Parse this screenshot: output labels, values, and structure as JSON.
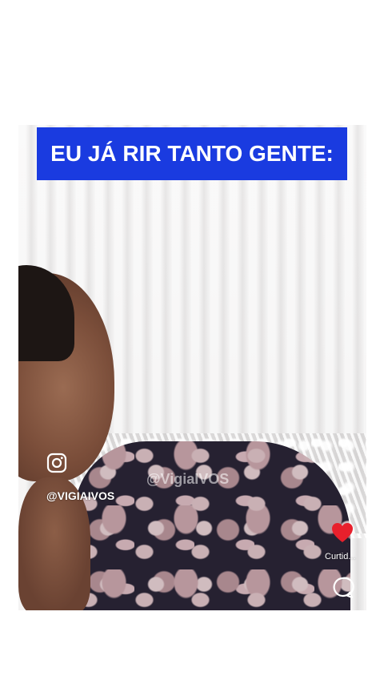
{
  "caption": "EU JÁ RIR TANTO GENTE:",
  "source": {
    "handle": "@VIGIAIVOS",
    "icon": "instagram-icon"
  },
  "watermark": "@VigiaIVOS",
  "actions": {
    "like_icon": "heart-icon",
    "like_label": "Curtid...",
    "comment_icon": "comment-icon"
  },
  "colors": {
    "banner_bg": "#1a3be0",
    "banner_text": "#ffffff",
    "heart": "#e8202c"
  }
}
